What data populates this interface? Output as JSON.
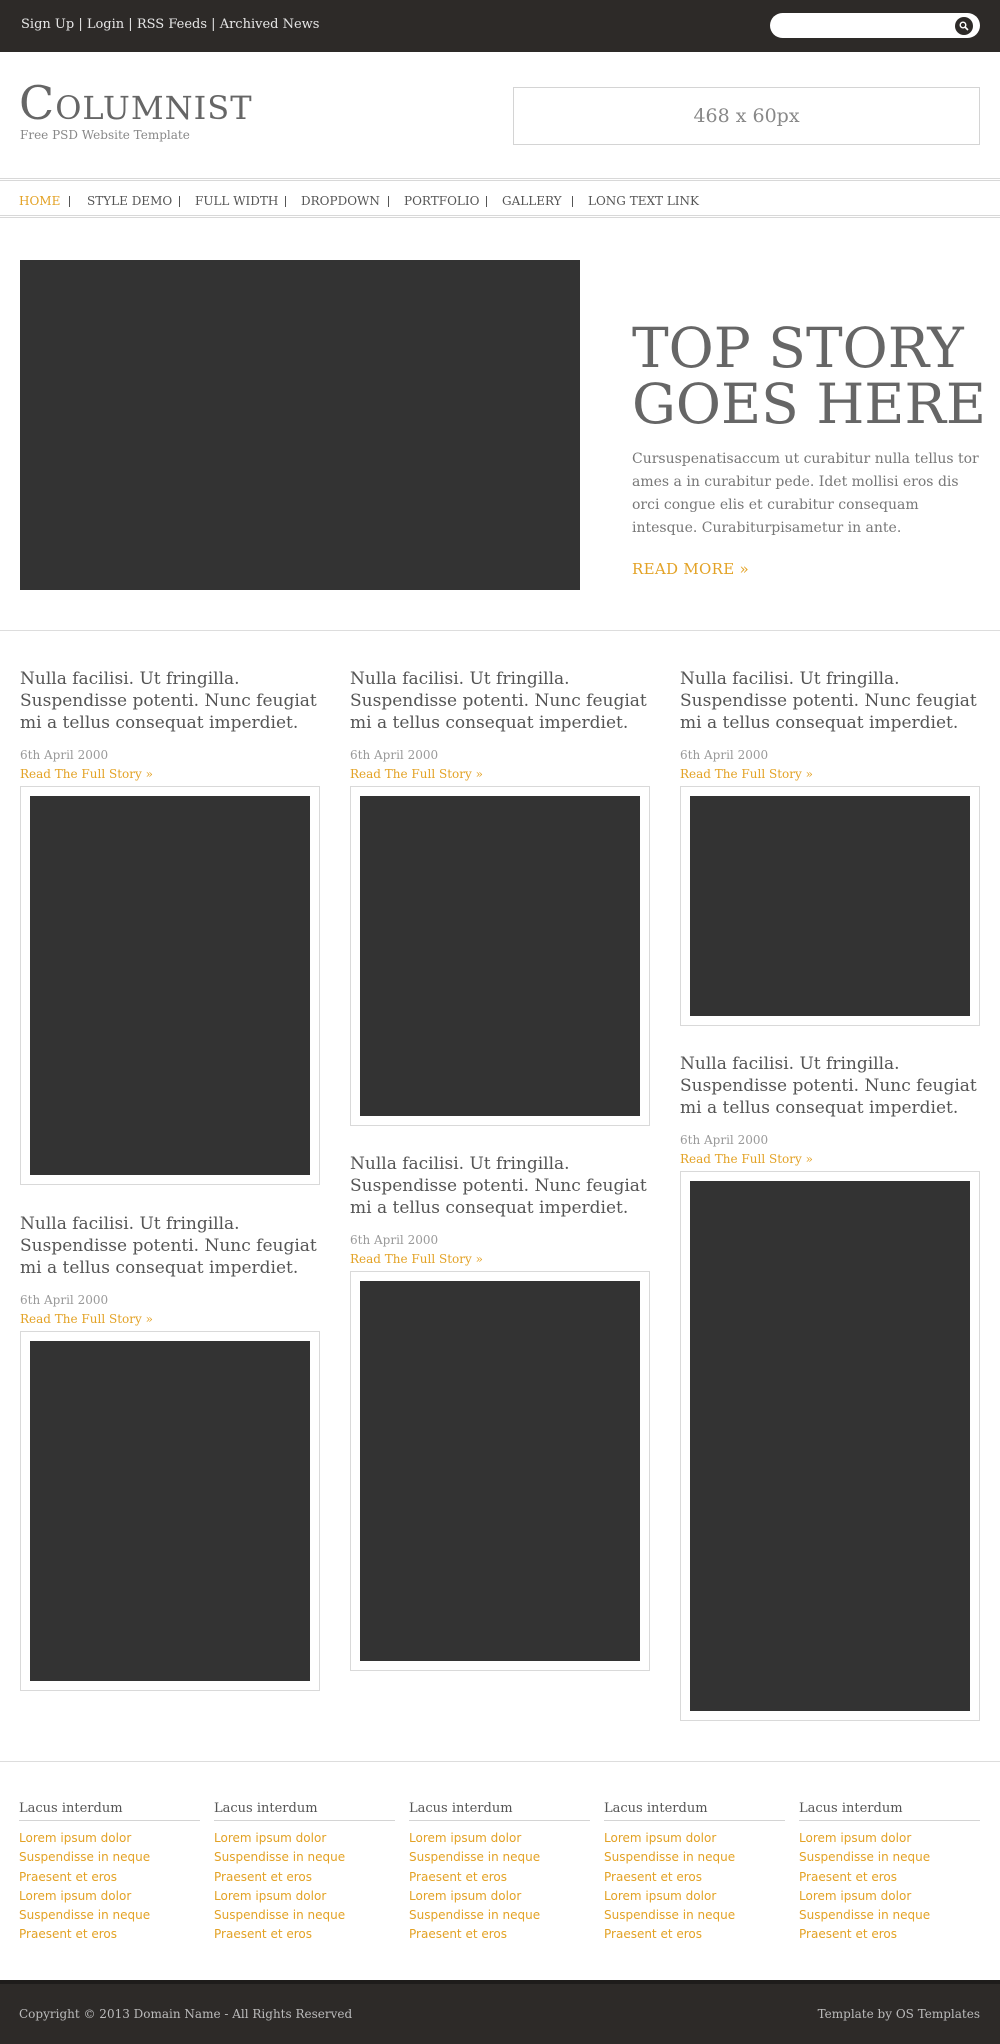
{
  "topbar": {
    "links": [
      "Sign Up",
      "Login",
      "RSS Feeds",
      "Archived News"
    ],
    "separator": "|",
    "search": {
      "value": "",
      "placeholder": ""
    }
  },
  "header": {
    "logo": "Columnist",
    "tagline": "Free PSD Website Template",
    "ad_label": "468 x 60px"
  },
  "nav": {
    "items": [
      "Home",
      "Style Demo",
      "Full Width",
      "Dropdown",
      "Portfolio",
      "Gallery",
      "Long Text Link"
    ]
  },
  "hero": {
    "title": "Top Story Goes Here",
    "text": "Cursuspenatisaccum ut curabitur nulla tellus tor ames a in curabitur pede. Idet mollisi eros dis orci congue elis et curabitur consequam intesque. Curabiturpisametur in ante.",
    "more": "Read More »"
  },
  "articles": [
    {
      "title": "Nulla facilisi. Ut fringilla. Suspendisse potenti. Nunc feugiat mi a tellus consequat imperdiet.",
      "date": "6th April 2000",
      "link": "Read The Full Story »"
    },
    {
      "title": "Nulla facilisi. Ut fringilla. Suspendisse potenti. Nunc feugiat mi a tellus consequat imperdiet.",
      "date": "6th April 2000",
      "link": "Read The Full Story »"
    },
    {
      "title": "Nulla facilisi. Ut fringilla. Suspendisse potenti. Nunc feugiat mi a tellus consequat imperdiet.",
      "date": "6th April 2000",
      "link": "Read The Full Story »"
    },
    {
      "title": "Nulla facilisi. Ut fringilla. Suspendisse potenti. Nunc feugiat mi a tellus consequat imperdiet.",
      "date": "6th April 2000",
      "link": "Read The Full Story »"
    },
    {
      "title": "Nulla facilisi. Ut fringilla. Suspendisse potenti. Nunc feugiat mi a tellus consequat imperdiet.",
      "date": "6th April 2000",
      "link": "Read The Full Story »"
    },
    {
      "title": "Nulla facilisi. Ut fringilla. Suspendisse potenti. Nunc feugiat mi a tellus consequat imperdiet.",
      "date": "6th April 2000",
      "link": "Read The Full Story »"
    }
  ],
  "footer_columns": [
    {
      "heading": "Lacus interdum",
      "links": [
        "Lorem ipsum dolor",
        "Suspendisse in neque",
        "Praesent et eros",
        "Lorem ipsum dolor",
        "Suspendisse in neque",
        "Praesent et eros"
      ]
    },
    {
      "heading": "Lacus interdum",
      "links": [
        "Lorem ipsum dolor",
        "Suspendisse in neque",
        "Praesent et eros",
        "Lorem ipsum dolor",
        "Suspendisse in neque",
        "Praesent et eros"
      ]
    },
    {
      "heading": "Lacus interdum",
      "links": [
        "Lorem ipsum dolor",
        "Suspendisse in neque",
        "Praesent et eros",
        "Lorem ipsum dolor",
        "Suspendisse in neque",
        "Praesent et eros"
      ]
    },
    {
      "heading": "Lacus interdum",
      "links": [
        "Lorem ipsum dolor",
        "Suspendisse in neque",
        "Praesent et eros",
        "Lorem ipsum dolor",
        "Suspendisse in neque",
        "Praesent et eros"
      ]
    },
    {
      "heading": "Lacus interdum",
      "links": [
        "Lorem ipsum dolor",
        "Suspendisse in neque",
        "Praesent et eros",
        "Lorem ipsum dolor",
        "Suspendisse in neque",
        "Praesent et eros"
      ]
    }
  ],
  "bottombar": {
    "copyright": "Copyright © 2013 Domain Name - All Rights Reserved",
    "credit": "Template by OS Templates"
  },
  "colors": {
    "accent": "#e3a225",
    "dark_bar": "#2d2a28",
    "placeholder_image": "#333333",
    "text": "#555555"
  },
  "icons": {
    "search_button": "search-icon"
  }
}
